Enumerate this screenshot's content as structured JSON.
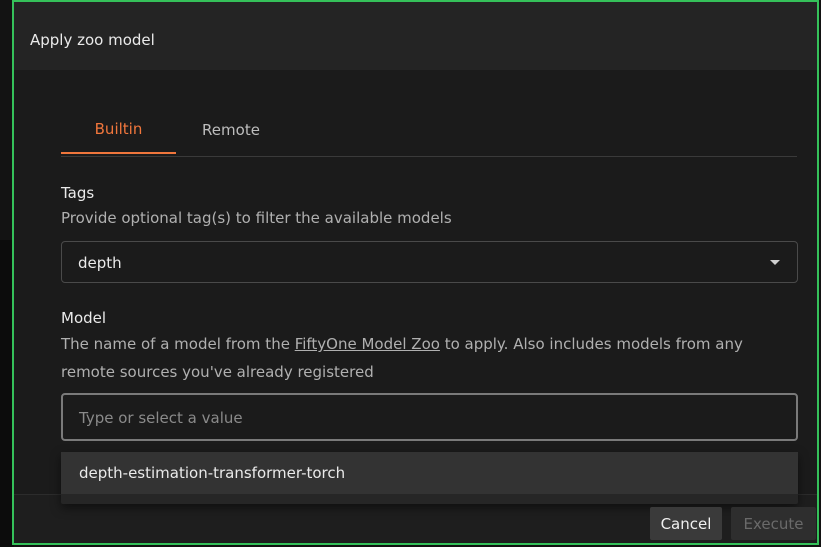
{
  "dialog": {
    "title": "Apply zoo model",
    "tabs": [
      {
        "label": "Builtin",
        "active": true
      },
      {
        "label": "Remote",
        "active": false
      }
    ],
    "tags": {
      "label": "Tags",
      "description": "Provide optional tag(s) to filter the available models",
      "value": "depth"
    },
    "model": {
      "label": "Model",
      "description_before": "The name of a model from the ",
      "description_link": "FiftyOne Model Zoo",
      "description_after": " to apply. Also includes models from any",
      "description_line2": "remote sources you've already registered",
      "placeholder": "Type or select a value",
      "options": [
        "depth-estimation-transformer-torch"
      ]
    },
    "footer": {
      "cancel_label": "Cancel",
      "execute_label": "Execute"
    }
  },
  "colors": {
    "accent": "#f0763c",
    "frame": "#35c15a",
    "background": "#1b1b1b"
  }
}
